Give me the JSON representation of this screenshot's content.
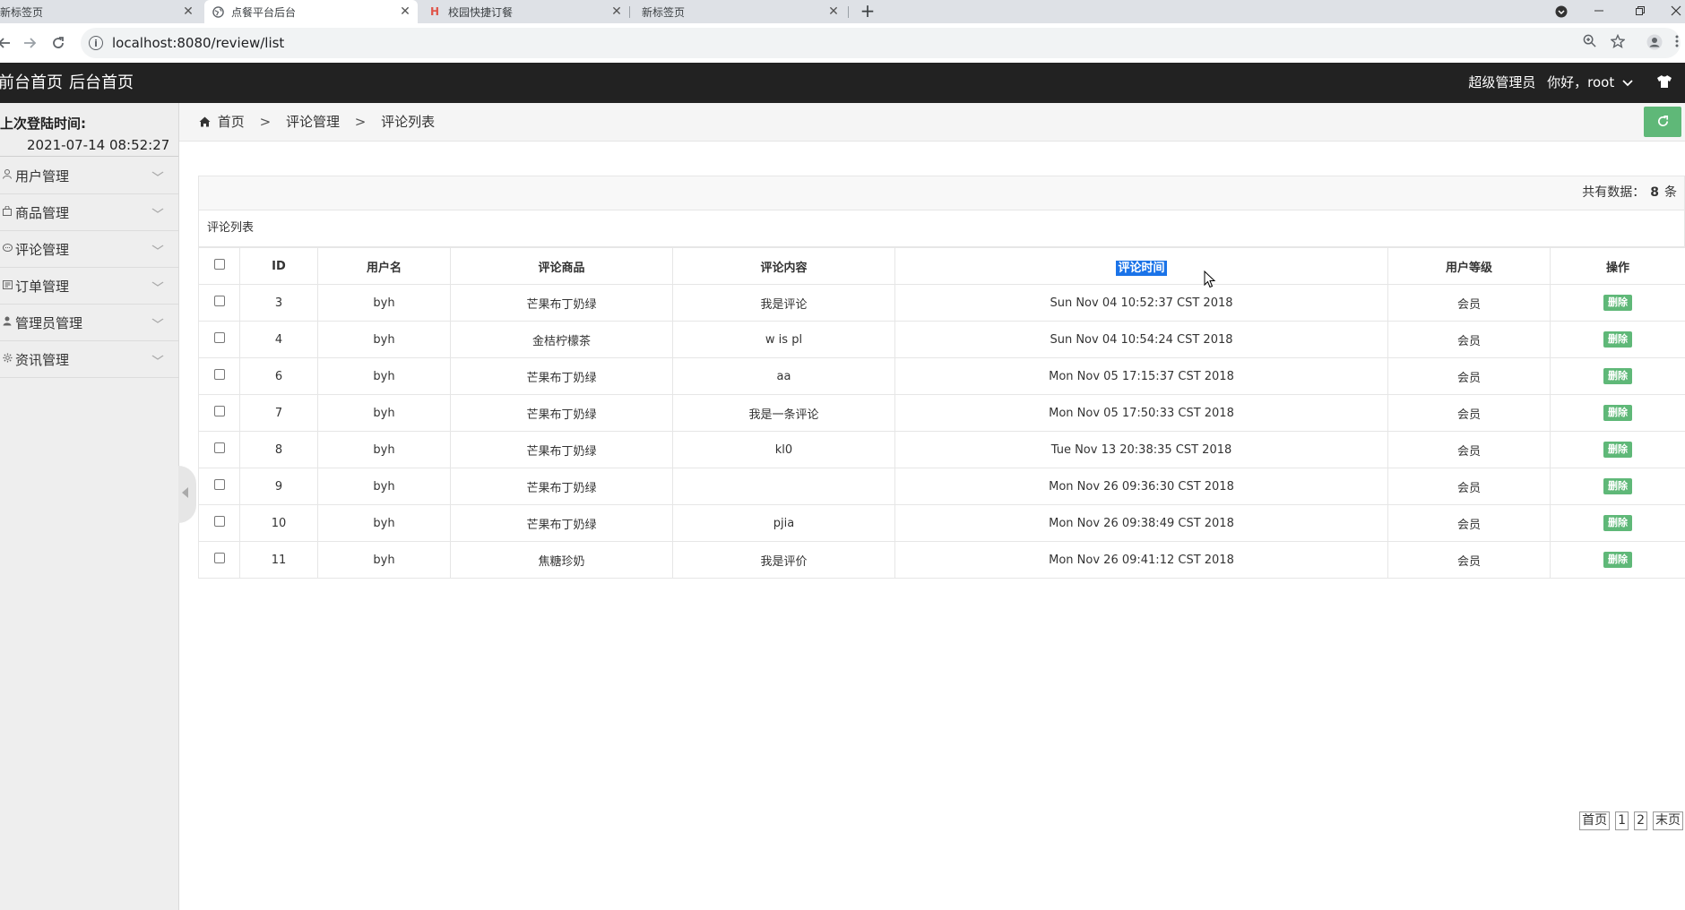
{
  "browser": {
    "tabs": [
      {
        "title": "新标签页",
        "active": false
      },
      {
        "title": "点餐平台后台",
        "active": true
      },
      {
        "title": "校园快捷订餐",
        "active": false
      },
      {
        "title": "新标签页",
        "active": false
      }
    ],
    "close_glyph": "✕",
    "new_tab_glyph": "+",
    "url": "localhost:8080/review/list"
  },
  "header": {
    "front_home": "前台首页",
    "back_home": "后台首页",
    "role": "超级管理员",
    "greeting": "你好，root"
  },
  "sidebar": {
    "last_login_label": "上次登陆时间:",
    "last_login_time": "2021-07-14 08:52:27",
    "items": [
      {
        "label": "用户管理",
        "icon": "user-icon"
      },
      {
        "label": "商品管理",
        "icon": "bag-icon"
      },
      {
        "label": "评论管理",
        "icon": "comment-icon"
      },
      {
        "label": "订单管理",
        "icon": "order-icon"
      },
      {
        "label": "管理员管理",
        "icon": "admin-icon"
      },
      {
        "label": "资讯管理",
        "icon": "gear-icon"
      }
    ]
  },
  "breadcrumb": {
    "home": "首页",
    "level2": "评论管理",
    "level3": "评论列表",
    "separator": ">"
  },
  "summary": {
    "prefix": "共有数据：",
    "count": "8",
    "suffix": "条"
  },
  "panel_title": "评论列表",
  "table": {
    "headers": {
      "id": "ID",
      "username": "用户名",
      "product": "评论商品",
      "content": "评论内容",
      "time": "评论时间",
      "level": "用户等级",
      "action": "操作"
    },
    "rows": [
      {
        "id": "3",
        "username": "byh",
        "product": "芒果布丁奶绿",
        "content": "我是评论",
        "time": "Sun Nov 04 10:52:37 CST 2018",
        "level": "会员",
        "action": "删除"
      },
      {
        "id": "4",
        "username": "byh",
        "product": "金桔柠檬茶",
        "content": "w is pl",
        "time": "Sun Nov 04 10:54:24 CST 2018",
        "level": "会员",
        "action": "删除"
      },
      {
        "id": "6",
        "username": "byh",
        "product": "芒果布丁奶绿",
        "content": "aa",
        "time": "Mon Nov 05 17:15:37 CST 2018",
        "level": "会员",
        "action": "删除"
      },
      {
        "id": "7",
        "username": "byh",
        "product": "芒果布丁奶绿",
        "content": "我是一条评论",
        "time": "Mon Nov 05 17:50:33 CST 2018",
        "level": "会员",
        "action": "删除"
      },
      {
        "id": "8",
        "username": "byh",
        "product": "芒果布丁奶绿",
        "content": "kl0",
        "time": "Tue Nov 13 20:38:35 CST 2018",
        "level": "会员",
        "action": "删除"
      },
      {
        "id": "9",
        "username": "byh",
        "product": "芒果布丁奶绿",
        "content": "",
        "time": "Mon Nov 26 09:36:30 CST 2018",
        "level": "会员",
        "action": "删除"
      },
      {
        "id": "10",
        "username": "byh",
        "product": "芒果布丁奶绿",
        "content": "pjia",
        "time": "Mon Nov 26 09:38:49 CST 2018",
        "level": "会员",
        "action": "删除"
      },
      {
        "id": "11",
        "username": "byh",
        "product": "焦糖珍奶",
        "content": "我是评价",
        "time": "Mon Nov 26 09:41:12 CST 2018",
        "level": "会员",
        "action": "删除"
      }
    ]
  },
  "pager": {
    "first": "首页",
    "pages": [
      "1",
      "2"
    ],
    "last": "末页"
  },
  "colors": {
    "header_bg": "#222222",
    "accent_green": "#5fb878",
    "selection_blue": "#1a73e8"
  }
}
